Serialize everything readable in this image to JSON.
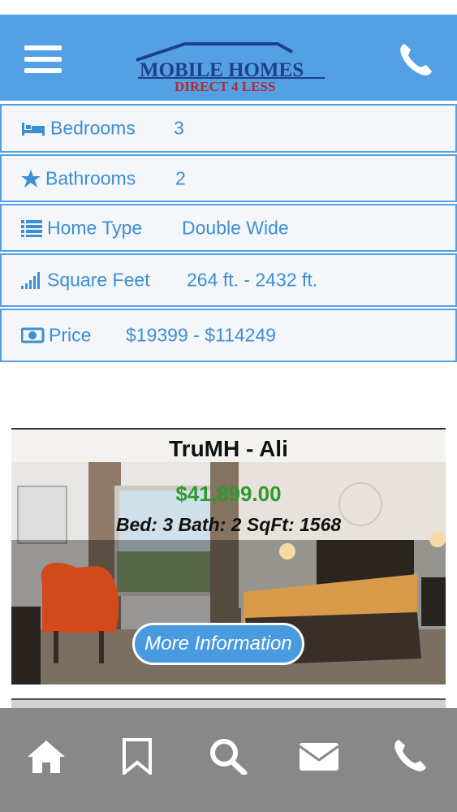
{
  "header": {
    "menu_icon": "hamburger-menu-icon",
    "logo_line1": "MOBILE HOMES",
    "logo_line2": "DIRECT 4 LESS",
    "phone_icon": "phone-icon"
  },
  "specs": [
    {
      "icon": "bed-icon",
      "label": "Bedrooms",
      "value": "3"
    },
    {
      "icon": "star-icon",
      "label": "Bathrooms",
      "value": "2"
    },
    {
      "icon": "list-icon",
      "label": "Home Type",
      "value": "Double Wide"
    },
    {
      "icon": "signal-bars-icon",
      "label": "Square Feet",
      "value": "264 ft. - 2432 ft."
    },
    {
      "icon": "money-icon",
      "label": "Price",
      "value": "$19399 - $114249"
    }
  ],
  "listing": {
    "title": "TruMH - Ali",
    "price": "$41,899.00",
    "stats": "Bed: 3  Bath: 2  SqFt: 1568",
    "button_label": "More Information"
  },
  "bottom_nav": [
    "home-icon",
    "bookmark-icon",
    "search-icon",
    "mail-icon",
    "phone-icon"
  ],
  "colors": {
    "brand_blue": "#54a0e4",
    "spec_text": "#3b8fd6",
    "price_green": "#2e9a2e",
    "nav_gray": "#888888"
  }
}
